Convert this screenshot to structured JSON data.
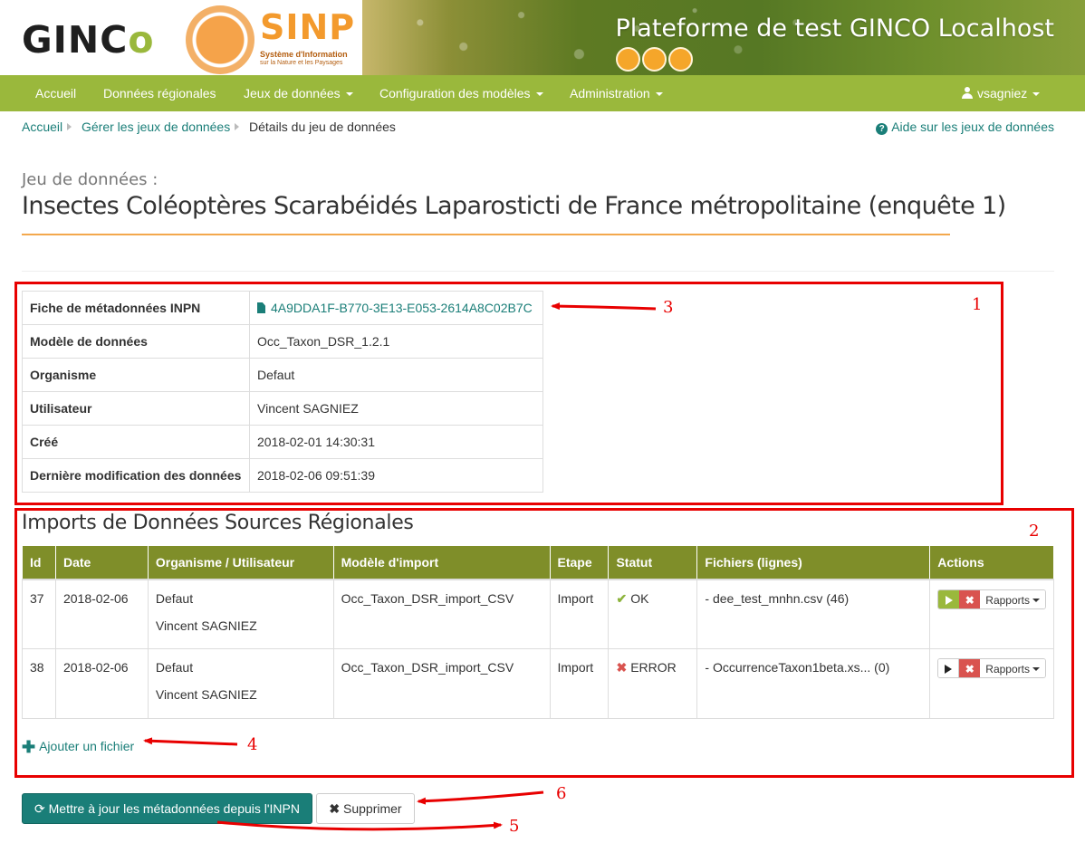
{
  "banner": {
    "logo_gin": "GIN",
    "logo_c": "C",
    "logo_o": "o",
    "sinp_word": "SINP",
    "sinp_sub": "Système d'Information",
    "sinp_sub2": "sur la Nature et les Paysages",
    "title": "Plateforme de test GINCO Localhost"
  },
  "nav": {
    "items": [
      {
        "label": "Accueil"
      },
      {
        "label": "Données régionales"
      },
      {
        "label": "Jeux de données"
      },
      {
        "label": "Configuration des modèles"
      },
      {
        "label": "Administration"
      }
    ],
    "user": "vsagniez"
  },
  "breadcrumb": {
    "home": "Accueil",
    "manage": "Gérer les jeux de données",
    "current": "Détails du jeu de données",
    "help": "Aide sur les jeux de données"
  },
  "page": {
    "subtitle": "Jeu de données :",
    "title": "Insectes Coléoptères Scarabéidés Laparosticti de France métropolitaine (enquête 1)"
  },
  "info": {
    "rows": [
      {
        "key": "Fiche de métadonnées INPN",
        "value": "4A9DDA1F-B770-3E13-E053-2614A8C02B7C"
      },
      {
        "key": "Modèle de données",
        "value": "Occ_Taxon_DSR_1.2.1"
      },
      {
        "key": "Organisme",
        "value": "Defaut"
      },
      {
        "key": "Utilisateur",
        "value": "Vincent SAGNIEZ"
      },
      {
        "key": "Créé",
        "value": "2018-02-01 14:30:31"
      },
      {
        "key": "Dernière modification des données",
        "value": "2018-02-06 09:51:39"
      }
    ]
  },
  "imports": {
    "title": "Imports de Données Sources Régionales",
    "headers": [
      "Id",
      "Date",
      "Organisme / Utilisateur",
      "Modèle d'import",
      "Etape",
      "Statut",
      "Fichiers (lignes)",
      "Actions"
    ],
    "rows": [
      {
        "id": "37",
        "date": "2018-02-06",
        "org": "Defaut",
        "user": "Vincent SAGNIEZ",
        "model": "Occ_Taxon_DSR_import_CSV",
        "step": "Import",
        "status": "OK",
        "files": "- dee_test_mnhn.csv (46)",
        "reports": "Rapports"
      },
      {
        "id": "38",
        "date": "2018-02-06",
        "org": "Defaut",
        "user": "Vincent SAGNIEZ",
        "model": "Occ_Taxon_DSR_import_CSV",
        "step": "Import",
        "status": "ERROR",
        "files": "- OccurrenceTaxon1beta.xs... (0)",
        "reports": "Rapports"
      }
    ],
    "add_file": "Ajouter un fichier"
  },
  "buttons": {
    "update": "Mettre à jour les métadonnées depuis l'INPN",
    "delete": "Supprimer"
  },
  "annotations": [
    "1",
    "2",
    "3",
    "4",
    "5",
    "6"
  ],
  "colors": {
    "nav_green": "#9ab83c",
    "table_header": "#7f8e29",
    "teal": "#1a7e78",
    "accent_orange": "#f3a84d",
    "annotation_red": "#e80000"
  }
}
